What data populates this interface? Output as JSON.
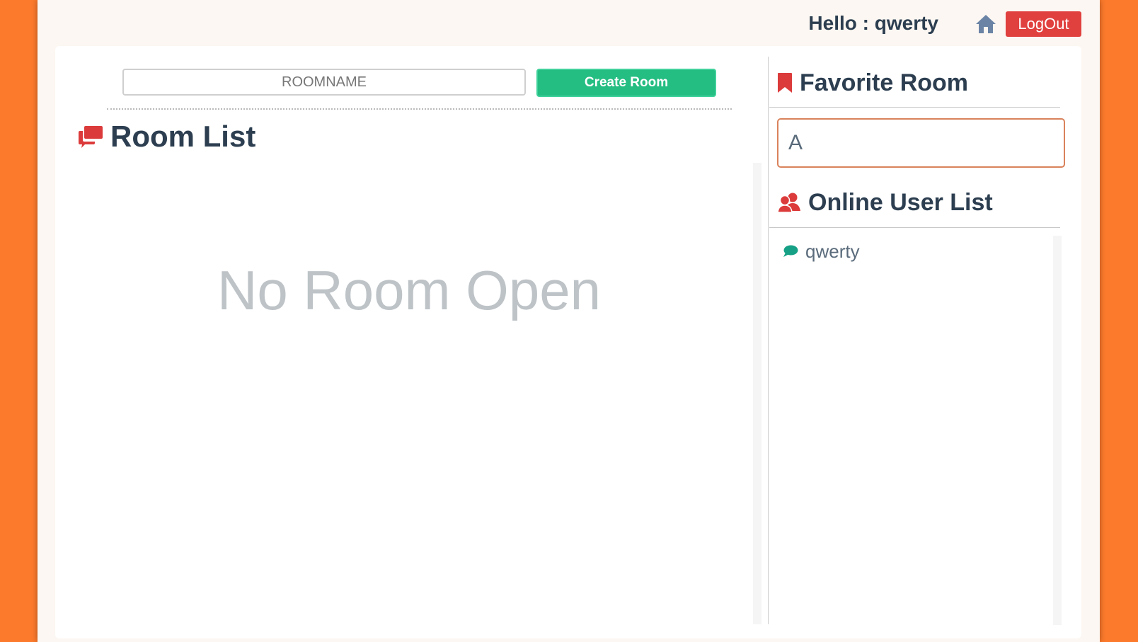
{
  "header": {
    "greeting": "Hello : qwerty",
    "home_icon": "home-icon",
    "logout_label": "LogOut"
  },
  "create_room": {
    "placeholder": "ROOMNAME",
    "button_label": "Create Room"
  },
  "room_list": {
    "icon": "chat-bubbles-icon",
    "title": "Room List",
    "empty_message": "No Room Open"
  },
  "favorite_room": {
    "icon": "bookmark-icon",
    "title": "Favorite Room",
    "input_value": "A"
  },
  "online_users": {
    "icon": "users-icon",
    "title": "Online User List",
    "users": [
      {
        "name": "qwerty",
        "icon": "chat-bubble-icon"
      }
    ]
  },
  "colors": {
    "background": "#fc7a2c",
    "logout": "#e0403e",
    "create": "#24bd82",
    "heading": "#2c3e50",
    "icon_red": "#dc3b3b",
    "user_icon": "#16a085"
  }
}
